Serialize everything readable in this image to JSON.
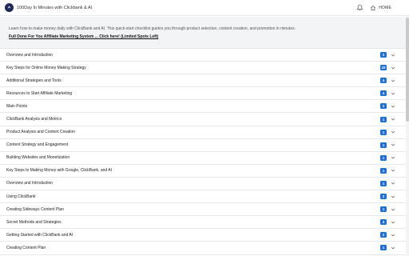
{
  "header": {
    "app_title": "100Day In Minutes with Clickbank & AI",
    "home_label": "HOME"
  },
  "intro": {
    "text": "Learn how to make money daily with ClickBank and AI. This quick-start checklist guides you through product selection, content creation, and promotion in minutes.",
    "link_label": "Full Done For You Affiliate Marketing System ... Click here! (Limited Spots Left)"
  },
  "modules": [
    {
      "title": "Overview and Introduction",
      "count": "3"
    },
    {
      "title": "Key Steps for Online Money Making Strategy",
      "count": "10"
    },
    {
      "title": "Additional Strategies and Tools",
      "count": "4"
    },
    {
      "title": "Resources to Start Affiliate Marketing",
      "count": "4"
    },
    {
      "title": "Main Points",
      "count": "2"
    },
    {
      "title": "ClickBank Analysis and Metrics",
      "count": "1"
    },
    {
      "title": "Product Analysis and Content Creation",
      "count": "1"
    },
    {
      "title": "Content Strategy and Engagement",
      "count": "1"
    },
    {
      "title": "Building Websites and Monetization",
      "count": "1"
    },
    {
      "title": "Key Steps to Making Money with Google, ClickBank, and AI",
      "count": "1"
    },
    {
      "title": "Overview and Introduction",
      "count": "1"
    },
    {
      "title": "Using ClickBank",
      "count": "2"
    },
    {
      "title": "Creating Sideways Content Plan",
      "count": "1"
    },
    {
      "title": "Secret Methods and Strategies",
      "count": "3"
    },
    {
      "title": "Getting Started with ClickBank and AI",
      "count": "2"
    },
    {
      "title": "Creating Content Plan",
      "count": "1"
    }
  ],
  "colors": {
    "accent": "#1f6fd6",
    "logo": "#1f2a5a"
  }
}
